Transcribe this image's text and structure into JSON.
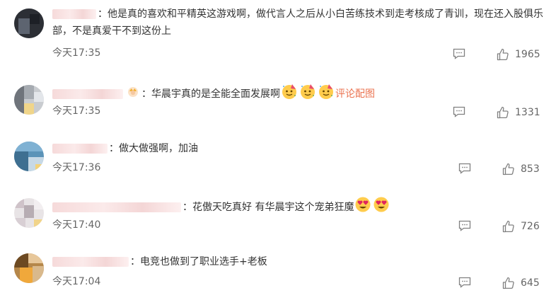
{
  "comments": [
    {
      "text": "：他是真的喜欢和平精英这游戏啊，做代言人之后从小白苦练技术到走考核成了青训，现在还入股俱乐部，不是真爱干不到这份上",
      "time": "今天17:35",
      "likes": "1965"
    },
    {
      "text": "：华晨宇真的是全能全面发展啊",
      "link": "评论配图",
      "time": "今天17:35",
      "likes": "1331",
      "emojis": [
        "party-face-emoji",
        "party-face-emoji",
        "party-face-emoji"
      ]
    },
    {
      "text": "：做大做强啊，加油",
      "time": "今天17:36",
      "likes": "853"
    },
    {
      "text": "：花傲天吃真好 有华晨宇这个宠弟狂魔",
      "time": "今天17:40",
      "likes": "726",
      "emojis": [
        "heart-eyes-emoji",
        "heart-eyes-emoji"
      ]
    },
    {
      "text": "：电竞也做到了职业选手+老板",
      "time": "今天17:04",
      "likes": "645"
    }
  ],
  "icons": {
    "reply": "comment-icon",
    "like": "thumbs-up-icon"
  },
  "colors": {
    "link": "#eb7350",
    "meta": "#666666",
    "text": "#333333"
  }
}
